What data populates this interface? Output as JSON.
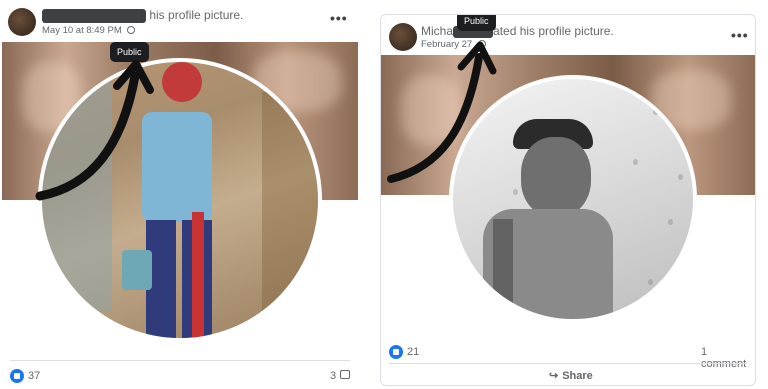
{
  "posts": [
    {
      "header_suffix": "his profile picture.",
      "date": "May 10 at 8:49 PM",
      "visibility_tooltip": "Public",
      "likes": "37",
      "comments": "3"
    },
    {
      "header_name_partial": "Micha",
      "header_suffix": "ated his profile picture.",
      "date": "February 27",
      "visibility_tooltip": "Public",
      "likes": "21",
      "comments": "1 comment",
      "share_label": "Share"
    }
  ],
  "colors": {
    "like_blue": "#1877f2",
    "text_secondary": "#65676b",
    "tooltip_bg": "#1c1e21"
  }
}
